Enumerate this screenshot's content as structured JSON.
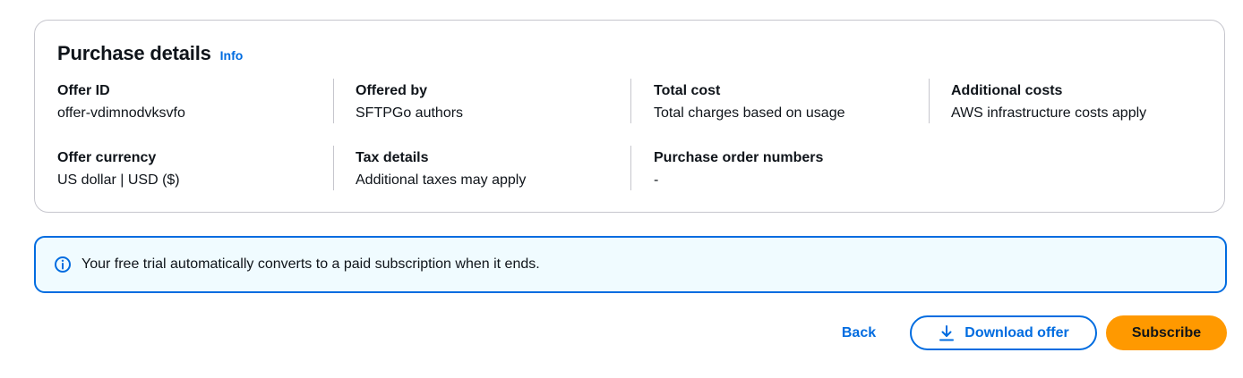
{
  "purchase_details": {
    "title": "Purchase details",
    "info_link": "Info",
    "fields": [
      {
        "label": "Offer ID",
        "value": "offer-vdimnodvksvfo"
      },
      {
        "label": "Offered by",
        "value": "SFTPGo authors"
      },
      {
        "label": "Total cost",
        "value": "Total charges based on usage"
      },
      {
        "label": "Additional costs",
        "value": "AWS infrastructure costs apply"
      },
      {
        "label": "Offer currency",
        "value": "US dollar | USD ($)"
      },
      {
        "label": "Tax details",
        "value": "Additional taxes may apply"
      },
      {
        "label": "Purchase order numbers",
        "value": "-"
      }
    ]
  },
  "alert": {
    "icon": "info-circle-icon",
    "message": "Your free trial automatically converts to a paid subscription when it ends."
  },
  "actions": {
    "back_label": "Back",
    "download_label": "Download offer",
    "download_icon": "download-icon",
    "subscribe_label": "Subscribe"
  },
  "colors": {
    "link_blue": "#006ce0",
    "alert_background": "#f0fbff",
    "primary_orange": "#ff9900",
    "border_gray": "#c6c6cd",
    "text_dark": "#0f141a"
  }
}
